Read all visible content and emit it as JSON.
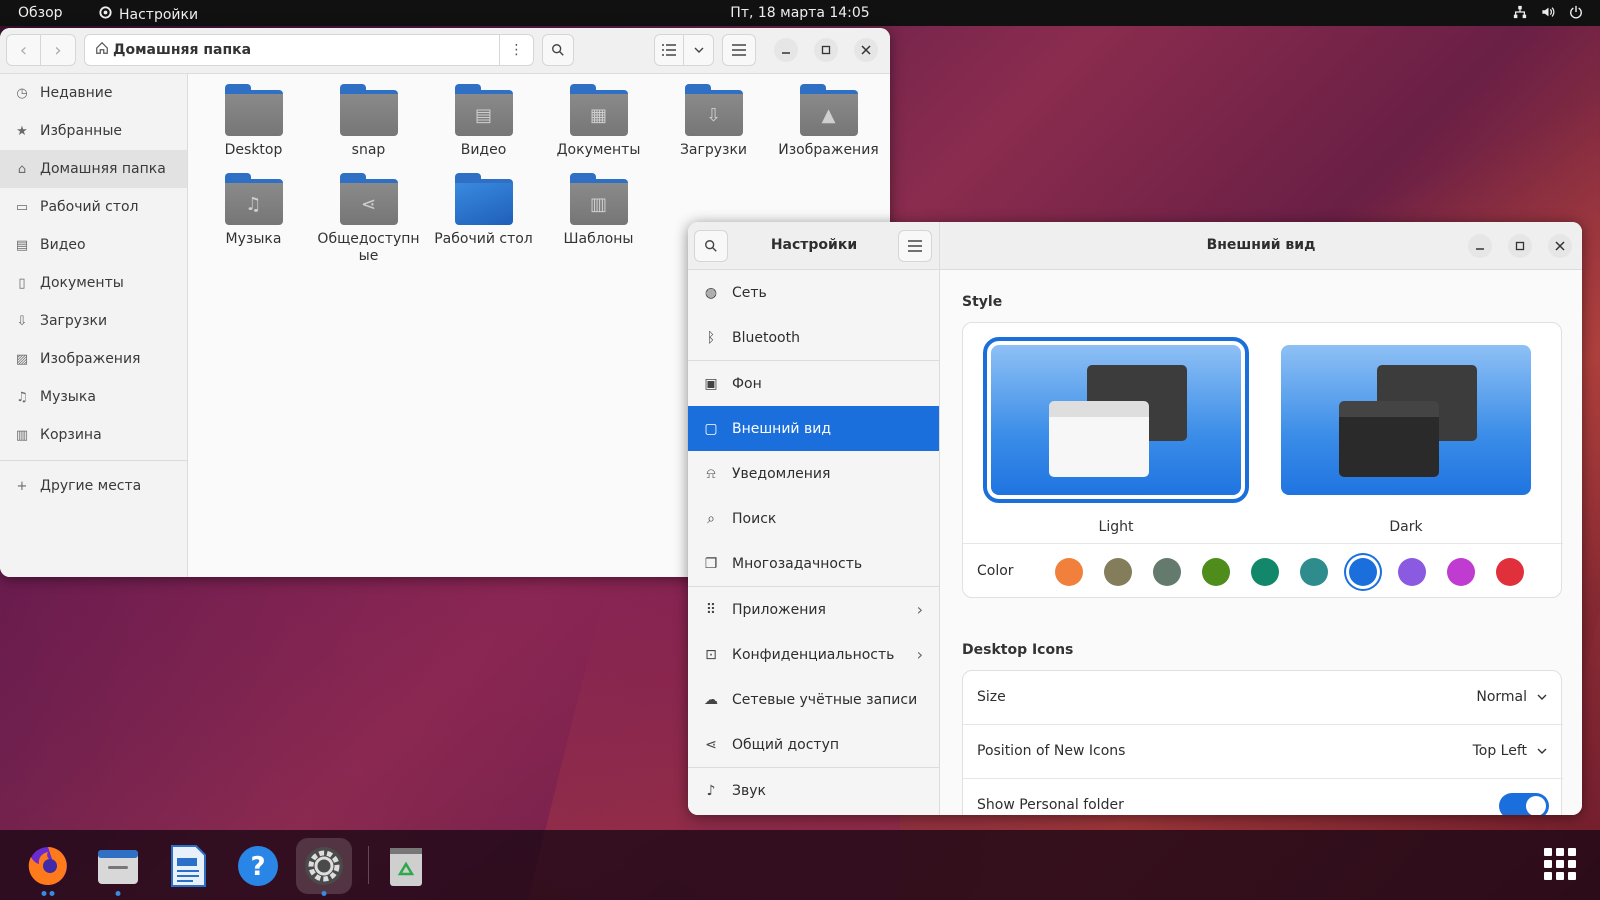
{
  "topbar": {
    "activities": "Обзор",
    "app_name": "Настройки",
    "clock": "Пт, 18 марта  14:05",
    "tray_icons": [
      "network-icon",
      "volume-icon",
      "power-icon"
    ]
  },
  "files": {
    "path": "Домашняя папка",
    "sidebar": [
      {
        "label": "Недавние",
        "icon": "clock-icon"
      },
      {
        "label": "Избранные",
        "icon": "star-icon"
      },
      {
        "label": "Домашняя папка",
        "icon": "home-icon",
        "active": true
      },
      {
        "label": "Рабочий стол",
        "icon": "desktop-icon"
      },
      {
        "label": "Видео",
        "icon": "film-icon"
      },
      {
        "label": "Документы",
        "icon": "document-icon"
      },
      {
        "label": "Загрузки",
        "icon": "download-icon"
      },
      {
        "label": "Изображения",
        "icon": "image-icon"
      },
      {
        "label": "Музыка",
        "icon": "music-icon"
      },
      {
        "label": "Корзина",
        "icon": "trash-icon"
      },
      {
        "label": "Другие места",
        "icon": "plus-icon"
      }
    ],
    "items": [
      {
        "label": "Desktop",
        "emblem": ""
      },
      {
        "label": "snap",
        "emblem": ""
      },
      {
        "label": "Видео",
        "emblem": "▤"
      },
      {
        "label": "Документы",
        "emblem": "▦"
      },
      {
        "label": "Загрузки",
        "emblem": "⇩"
      },
      {
        "label": "Изображения",
        "emblem": "▲"
      },
      {
        "label": "Музыка",
        "emblem": "♫"
      },
      {
        "label": "Общедоступные",
        "emblem": "⋖"
      },
      {
        "label": "Рабочий стол",
        "emblem": "",
        "blue": true
      },
      {
        "label": "Шаблоны",
        "emblem": "▥"
      }
    ]
  },
  "settings": {
    "title": "Настройки",
    "panel_title": "Внешний вид",
    "nav": [
      {
        "label": "Сеть",
        "icon": "globe-icon"
      },
      {
        "label": "Bluetooth",
        "icon": "bluetooth-icon",
        "sep_after": true
      },
      {
        "label": "Фон",
        "icon": "background-icon"
      },
      {
        "label": "Внешний вид",
        "icon": "appearance-icon",
        "active": true
      },
      {
        "label": "Уведомления",
        "icon": "bell-icon"
      },
      {
        "label": "Поиск",
        "icon": "search-icon"
      },
      {
        "label": "Многозадачность",
        "icon": "multitasking-icon",
        "sep_after": true
      },
      {
        "label": "Приложения",
        "icon": "apps-icon",
        "chevron": true
      },
      {
        "label": "Конфиденциальность",
        "icon": "lock-icon",
        "chevron": true
      },
      {
        "label": "Сетевые учётные записи",
        "icon": "cloud-icon"
      },
      {
        "label": "Общий доступ",
        "icon": "share-icon",
        "sep_after": true
      },
      {
        "label": "Звук",
        "icon": "music-note-icon"
      }
    ],
    "style_title": "Style",
    "style_light": "Light",
    "style_dark": "Dark",
    "color_label": "Color",
    "accent_colors": [
      "#f0803c",
      "#847d5c",
      "#637a6c",
      "#4e8c1c",
      "#13876a",
      "#2e8c8c",
      "#1a6fdc",
      "#8a5ae0",
      "#c03cd0",
      "#e0303c"
    ],
    "selected_color_index": 6,
    "desktop_icons_title": "Desktop Icons",
    "size_label": "Size",
    "size_value": "Normal",
    "position_label": "Position of New Icons",
    "position_value": "Top Left",
    "personal_folder_label": "Show Personal folder",
    "personal_folder_on": true
  }
}
